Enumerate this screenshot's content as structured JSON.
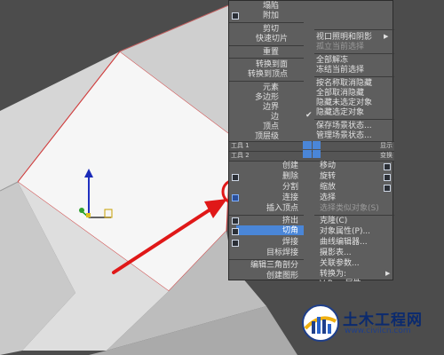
{
  "colors": {
    "viewport_bg": "#4c4c4c",
    "face_white": "#f4f4f4",
    "face_light": "#d8d8d8",
    "face_mid": "#b8b8b8",
    "edge_red": "#d04040",
    "menu_bg": "#5e5e5e",
    "highlight": "#4a86d8",
    "annotation_red": "#e01818",
    "logo_blue": "#0b2a6e"
  },
  "quad_menu": {
    "top_left": {
      "items": [
        "塌陷",
        "附加",
        "剪切",
        "快速切片",
        "重置",
        "转换到面",
        "转换到顶点",
        "元素",
        "多边形",
        "边界",
        "边",
        "顶点",
        "顶层级"
      ],
      "title": "工具 1"
    },
    "top_right": {
      "items": [
        "视口照明和阴影",
        "孤立当前选择",
        "全部解冻",
        "冻结当前选择",
        "按名称取消隐藏",
        "全部取消隐藏",
        "隐藏未选定对象",
        "隐藏选定对象",
        "保存场景状态...",
        "管理场景状态..."
      ],
      "title": "显示"
    },
    "bottom_left": {
      "title": "工具 2",
      "items": [
        "创建",
        "删除",
        "分割",
        "连接",
        "插入顶点",
        "挤出",
        "切角",
        "焊接",
        "目标焊接",
        "编辑三角剖分",
        "创建图形"
      ]
    },
    "bottom_right": {
      "title": "变换",
      "items": [
        "移动",
        "旋转",
        "缩放",
        "选择",
        "选择类似对象(S)",
        "克隆(C)",
        "对象属性(P)...",
        "曲线编辑器...",
        "摄影表...",
        "关联参数...",
        "转换为:",
        "V-Ray 属性"
      ]
    }
  },
  "logo": {
    "name": "土木工程网",
    "url": "www.civilcn.com"
  }
}
